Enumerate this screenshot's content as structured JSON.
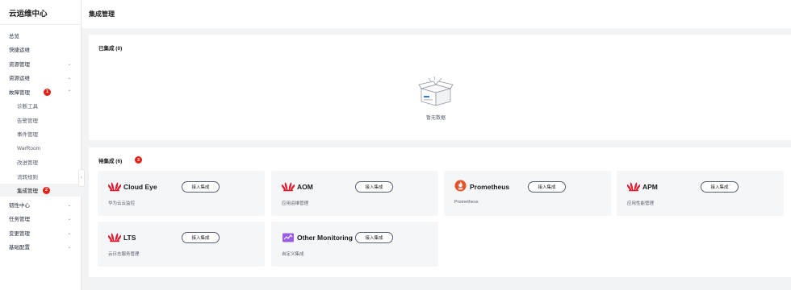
{
  "app": {
    "title": "云运维中心"
  },
  "header": {
    "title": "集成管理"
  },
  "sidebar": {
    "items": [
      {
        "label": "总览"
      },
      {
        "label": "快捷运维"
      },
      {
        "label": "资源管理"
      },
      {
        "label": "资源运维"
      },
      {
        "label": "故障管理",
        "badge": "1"
      },
      {
        "label": "诊断工具"
      },
      {
        "label": "告警管理"
      },
      {
        "label": "事件管理"
      },
      {
        "label": "WarRoom"
      },
      {
        "label": "改进管理"
      },
      {
        "label": "流转规则"
      },
      {
        "label": "集成管理",
        "badge": "2"
      },
      {
        "label": "韧性中心"
      },
      {
        "label": "任务管理"
      },
      {
        "label": "变更管理"
      },
      {
        "label": "基础配置"
      }
    ],
    "collapse_glyph": "‹",
    "chevron_down": "⌄",
    "chevron_up": "⌃"
  },
  "integrated": {
    "title": "已集成 (0)",
    "empty_text": "暂无数据"
  },
  "pending": {
    "title": "待集成 (6)",
    "badge": "3",
    "cards": [
      {
        "name": "Cloud Eye",
        "desc": "华为云云监控",
        "button": "接入集成",
        "icon": "huawei-logo-icon"
      },
      {
        "name": "AOM",
        "desc": "应用运维管理",
        "button": "接入集成",
        "icon": "huawei-logo-icon"
      },
      {
        "name": "Prometheus",
        "desc": "Prometheus",
        "button": "接入集成",
        "icon": "prometheus-logo-icon"
      },
      {
        "name": "APM",
        "desc": "应用性能管理",
        "button": "接入集成",
        "icon": "huawei-logo-icon"
      },
      {
        "name": "LTS",
        "desc": "云日志服务管理",
        "button": "接入集成",
        "icon": "huawei-logo-icon"
      },
      {
        "name": "Other Monitoring",
        "desc": "自定义集成",
        "button": "接入集成",
        "icon": "monitoring-chart-icon"
      }
    ]
  },
  "colors": {
    "badge": "#e62014",
    "huawei": "#e3172d",
    "prometheus": "#e6522c",
    "custom": "#9b5de5"
  }
}
